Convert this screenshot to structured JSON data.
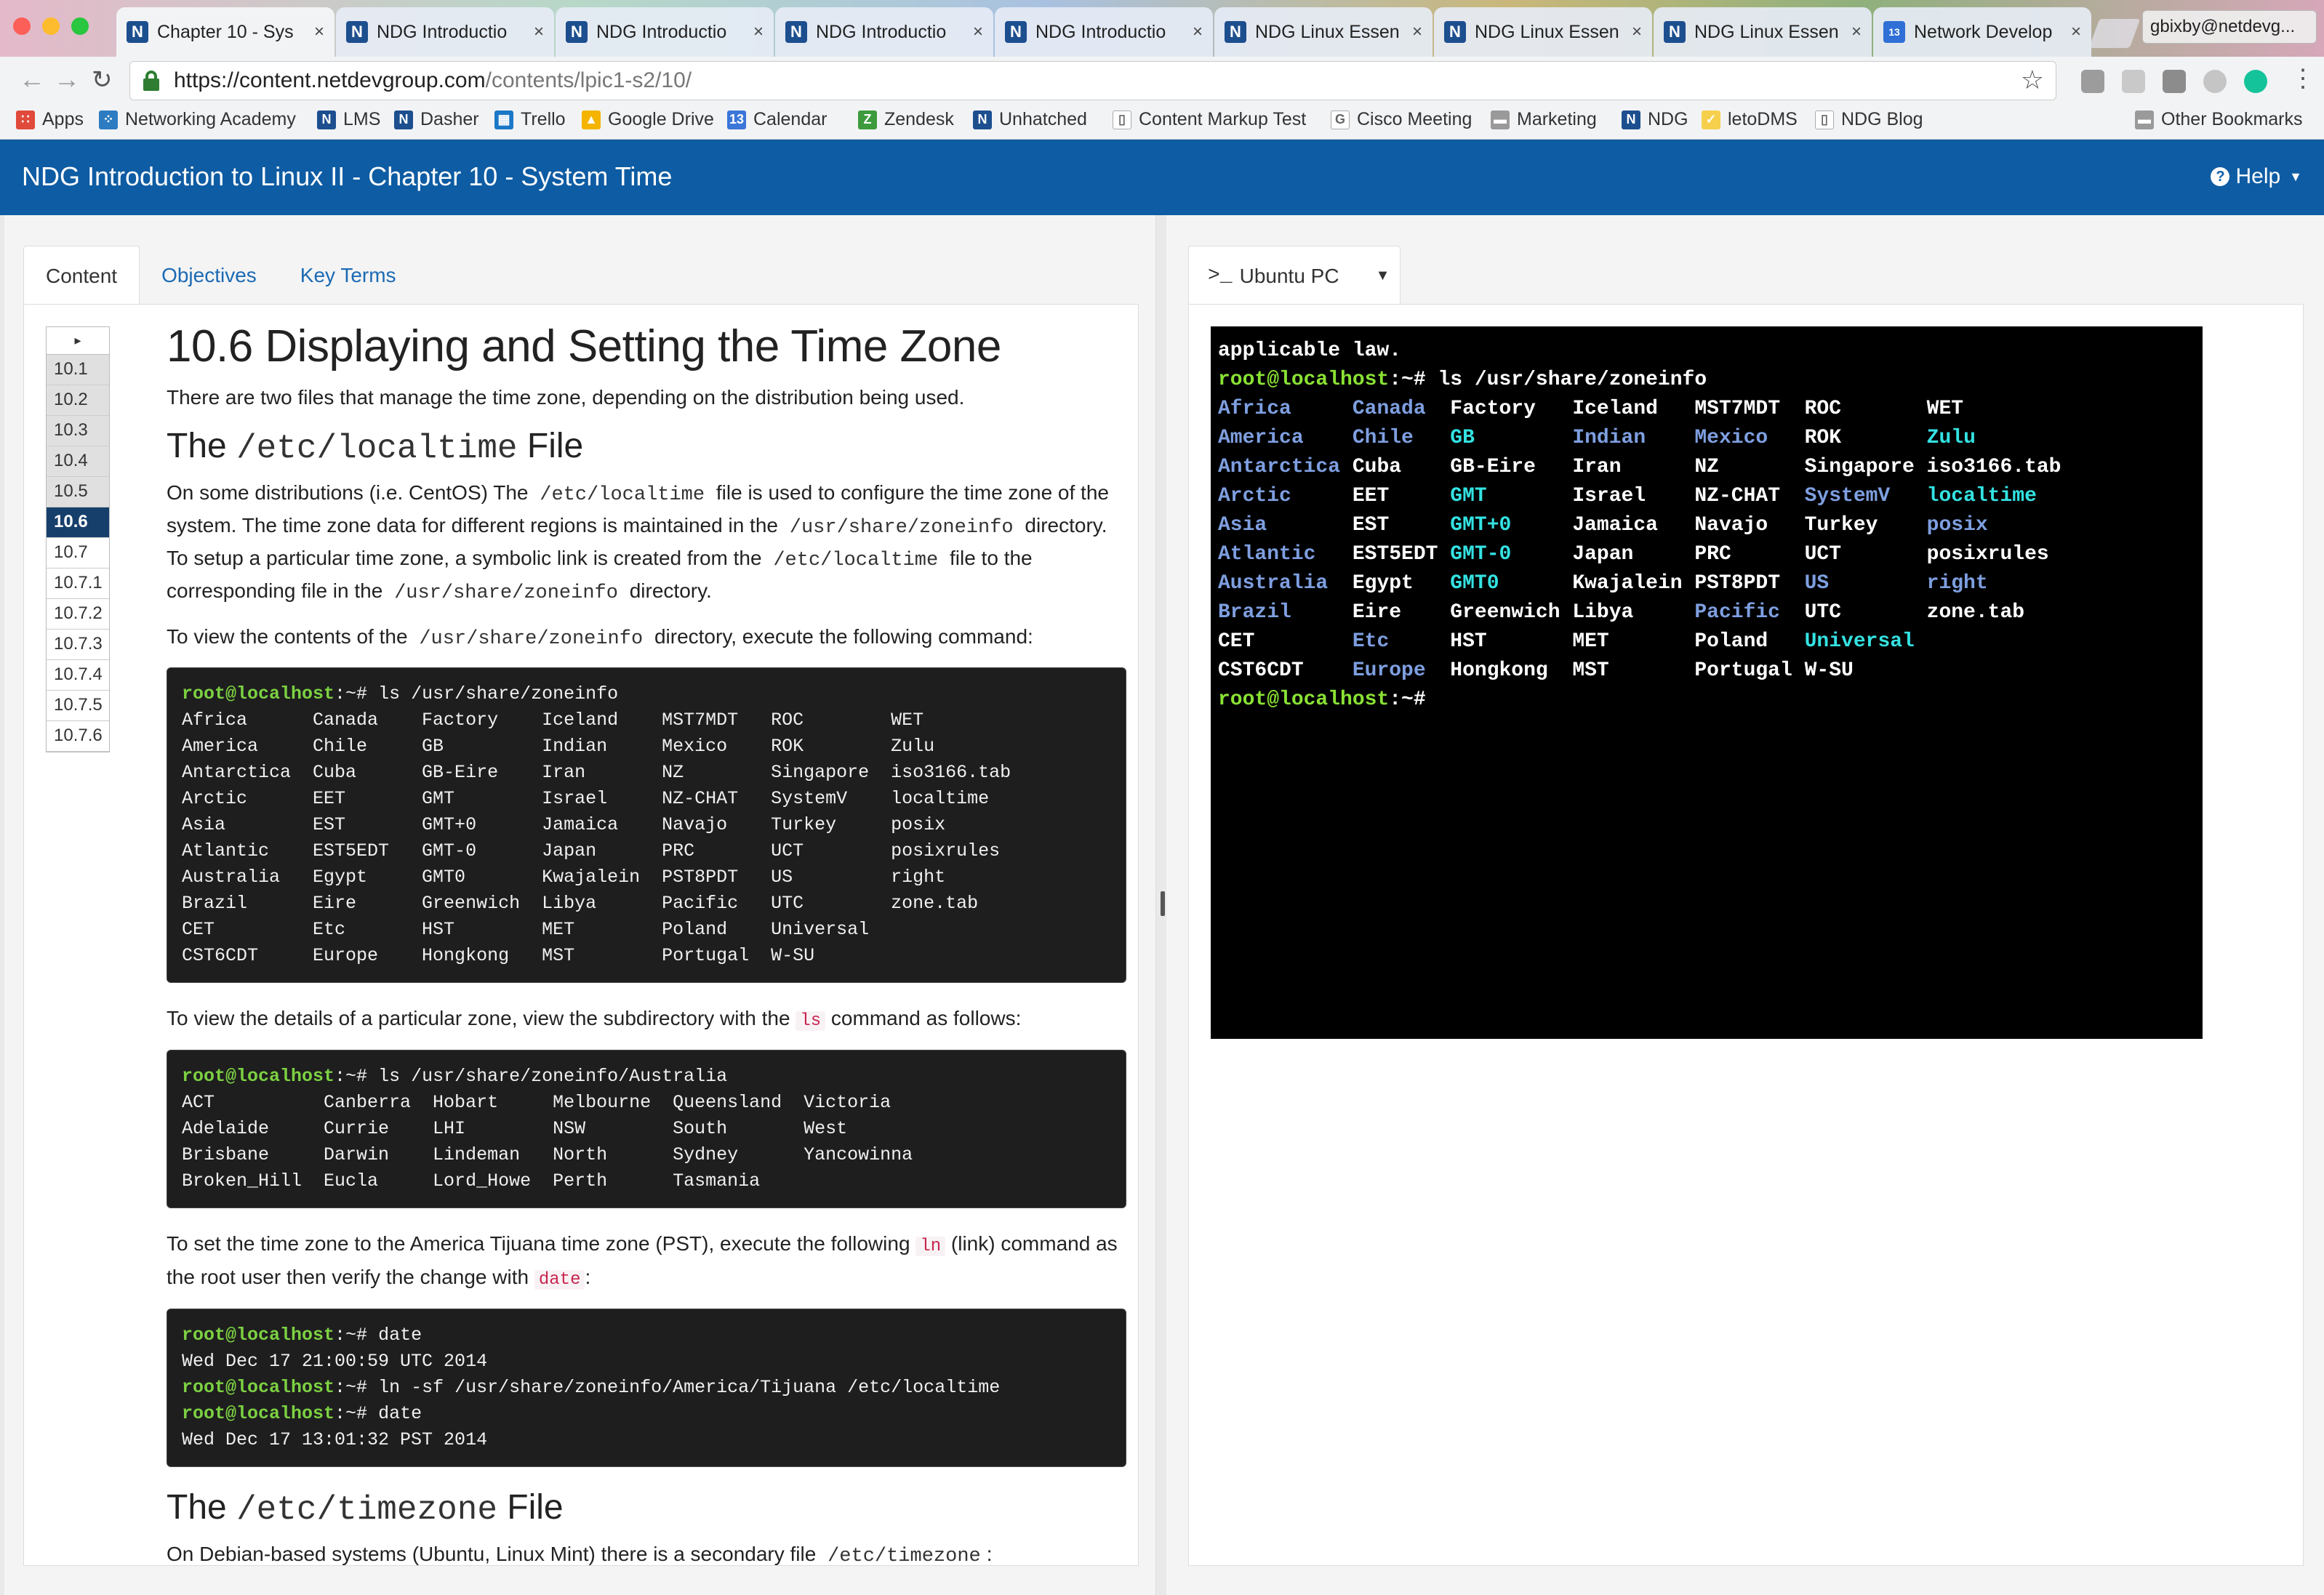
{
  "browser": {
    "tabs": [
      {
        "icon": "N",
        "title": "Chapter 10 - Sys",
        "active": true
      },
      {
        "icon": "N",
        "title": "NDG Introductio"
      },
      {
        "icon": "N",
        "title": "NDG Introductio"
      },
      {
        "icon": "N",
        "title": "NDG Introductio"
      },
      {
        "icon": "N",
        "title": "NDG Introductio"
      },
      {
        "icon": "N",
        "title": "NDG Linux Essen"
      },
      {
        "icon": "N",
        "title": "NDG Linux Essen"
      },
      {
        "icon": "N",
        "title": "NDG Linux Essen"
      },
      {
        "icon": "13",
        "title": "Network Develop"
      }
    ],
    "profile": "gbixby@netdevg...",
    "url_host": "https://content.netdevgroup.com",
    "url_path": "/contents/lpic1-s2/10/",
    "bookmarks": [
      {
        "label": "Apps",
        "icon": "apps-grid-icon"
      },
      {
        "label": "Networking Academy",
        "icon": "cisco-icon"
      },
      {
        "label": "LMS",
        "icon": "ndg-n-icon"
      },
      {
        "label": "Dasher",
        "icon": "ndg-n-icon"
      },
      {
        "label": "Trello",
        "icon": "trello-icon"
      },
      {
        "label": "Google Drive",
        "icon": "drive-icon"
      },
      {
        "label": "Calendar",
        "icon": "calendar-icon"
      },
      {
        "label": "Zendesk",
        "icon": "zendesk-icon"
      },
      {
        "label": "Unhatched",
        "icon": "ndg-n-icon"
      },
      {
        "label": "Content Markup Test",
        "icon": "page-icon"
      },
      {
        "label": "Cisco Meeting",
        "icon": "google-icon"
      },
      {
        "label": "Marketing",
        "icon": "folder-icon"
      },
      {
        "label": "NDG",
        "icon": "ndg-n-icon"
      },
      {
        "label": "letoDMS",
        "icon": "leto-icon"
      },
      {
        "label": "NDG Blog",
        "icon": "page-icon"
      },
      {
        "label": "Other Bookmarks",
        "icon": "folder-icon"
      }
    ]
  },
  "header": {
    "title": "NDG Introduction to Linux II - Chapter 10 - System Time",
    "help": "Help"
  },
  "content_tabs": [
    "Content",
    "Objectives",
    "Key Terms"
  ],
  "section_nav": [
    "10.1",
    "10.2",
    "10.3",
    "10.4",
    "10.5",
    "10.6",
    "10.7",
    "10.7.1",
    "10.7.2",
    "10.7.3",
    "10.7.4",
    "10.7.5",
    "10.7.6"
  ],
  "section_nav_active": "10.6",
  "article": {
    "title": "10.6 Displaying and Setting the Time Zone",
    "intro": "There are two files that manage the time zone, depending on the distribution being used.",
    "h2_localtime": {
      "pre": "The",
      "code": "/etc/localtime",
      "post": "File"
    },
    "p1": {
      "a": "On some distributions (i.e. CentOS) The",
      "c1": "/etc/localtime",
      "b": "file is used to configure the time zone of the system. The time zone data for different regions is maintained in the",
      "c2": "/usr/share/zoneinfo",
      "c": "directory. To setup a particular time zone, a symbolic link is created from the",
      "c3": "/etc/localtime",
      "d": "file to the corresponding file in the",
      "c4": "/usr/share/zoneinfo",
      "e": "directory."
    },
    "p2": {
      "a": "To view the contents of the",
      "c1": "/usr/share/zoneinfo",
      "b": "directory, execute the following command:"
    },
    "code1": {
      "prompt": "root@localhost",
      "suffix": ":~#",
      "command": " ls /usr/share/zoneinfo",
      "output": "Africa      Canada    Factory    Iceland    MST7MDT   ROC        WET\nAmerica     Chile     GB         Indian     Mexico    ROK        Zulu\nAntarctica  Cuba      GB-Eire    Iran       NZ        Singapore  iso3166.tab\nArctic      EET       GMT        Israel     NZ-CHAT   SystemV    localtime\nAsia        EST       GMT+0      Jamaica    Navajo    Turkey     posix\nAtlantic    EST5EDT   GMT-0      Japan      PRC       UCT        posixrules\nAustralia   Egypt     GMT0       Kwajalein  PST8PDT   US         right\nBrazil      Eire      Greenwich  Libya      Pacific   UTC        zone.tab\nCET         Etc       HST        MET        Poland    Universal\nCST6CDT     Europe    Hongkong   MST        Portugal  W-SU"
    },
    "p3": {
      "a": "To view the details of a particular zone, view the subdirectory with the",
      "c1": "ls",
      "b": "command as follows:"
    },
    "code2": {
      "prompt": "root@localhost",
      "suffix": ":~#",
      "command": " ls /usr/share/zoneinfo/Australia",
      "output": "ACT          Canberra  Hobart     Melbourne  Queensland  Victoria\nAdelaide     Currie    LHI        NSW        South       West\nBrisbane     Darwin    Lindeman   North      Sydney      Yancowinna\nBroken_Hill  Eucla     Lord_Howe  Perth      Tasmania"
    },
    "p4": {
      "a": "To set the time zone to the America Tijuana time zone (PST), execute the following",
      "c1": "ln",
      "b": "(link) command as the root user then verify the change with",
      "c2": "date",
      "c": ":"
    },
    "code3": {
      "prompt": "root@localhost",
      "suffix": ":~#",
      "cmd1": " date",
      "out1": "Wed Dec 17 21:00:59 UTC 2014",
      "cmd2": " ln -sf /usr/share/zoneinfo/America/Tijuana /etc/localtime",
      "cmd3": " date",
      "out3": "Wed Dec 17 13:01:32 PST 2014"
    },
    "h2_timezone": {
      "pre": "The",
      "code": "/etc/timezone",
      "post": "File"
    },
    "p5": {
      "a": "On Debian-based systems (Ubuntu, Linux Mint) there is a secondary file",
      "c1": "/etc/timezone",
      "b": ":"
    }
  },
  "terminal_tab": {
    "label": "Ubuntu PC"
  },
  "terminal": {
    "line0": "applicable law.",
    "prompt": "root@localhost",
    "suffix": ":~#",
    "command": " ls /usr/share/zoneinfo",
    "rows": [
      [
        [
          "Africa",
          "b"
        ],
        [
          "Canada",
          "b"
        ],
        [
          "Factory",
          "w"
        ],
        [
          "Iceland",
          "w"
        ],
        [
          "MST7MDT",
          "w"
        ],
        [
          "ROC",
          "w"
        ],
        [
          "WET",
          "w"
        ]
      ],
      [
        [
          "America",
          "b"
        ],
        [
          "Chile",
          "b"
        ],
        [
          "GB",
          "c"
        ],
        [
          "Indian",
          "b"
        ],
        [
          "Mexico",
          "b"
        ],
        [
          "ROK",
          "w"
        ],
        [
          "Zulu",
          "c"
        ]
      ],
      [
        [
          "Antarctica",
          "b"
        ],
        [
          "Cuba",
          "w"
        ],
        [
          "GB-Eire",
          "w"
        ],
        [
          "Iran",
          "w"
        ],
        [
          "NZ",
          "w"
        ],
        [
          "Singapore",
          "w"
        ],
        [
          "iso3166.tab",
          "w"
        ]
      ],
      [
        [
          "Arctic",
          "b"
        ],
        [
          "EET",
          "w"
        ],
        [
          "GMT",
          "c"
        ],
        [
          "Israel",
          "w"
        ],
        [
          "NZ-CHAT",
          "w"
        ],
        [
          "SystemV",
          "b"
        ],
        [
          "localtime",
          "c"
        ]
      ],
      [
        [
          "Asia",
          "b"
        ],
        [
          "EST",
          "w"
        ],
        [
          "GMT+0",
          "c"
        ],
        [
          "Jamaica",
          "w"
        ],
        [
          "Navajo",
          "w"
        ],
        [
          "Turkey",
          "w"
        ],
        [
          "posix",
          "b"
        ]
      ],
      [
        [
          "Atlantic",
          "b"
        ],
        [
          "EST5EDT",
          "w"
        ],
        [
          "GMT-0",
          "c"
        ],
        [
          "Japan",
          "w"
        ],
        [
          "PRC",
          "w"
        ],
        [
          "UCT",
          "w"
        ],
        [
          "posixrules",
          "w"
        ]
      ],
      [
        [
          "Australia",
          "b"
        ],
        [
          "Egypt",
          "w"
        ],
        [
          "GMT0",
          "c"
        ],
        [
          "Kwajalein",
          "w"
        ],
        [
          "PST8PDT",
          "w"
        ],
        [
          "US",
          "b"
        ],
        [
          "right",
          "b"
        ]
      ],
      [
        [
          "Brazil",
          "b"
        ],
        [
          "Eire",
          "w"
        ],
        [
          "Greenwich",
          "w"
        ],
        [
          "Libya",
          "w"
        ],
        [
          "Pacific",
          "b"
        ],
        [
          "UTC",
          "w"
        ],
        [
          "zone.tab",
          "w"
        ]
      ],
      [
        [
          "CET",
          "w"
        ],
        [
          "Etc",
          "b"
        ],
        [
          "HST",
          "w"
        ],
        [
          "MET",
          "w"
        ],
        [
          "Poland",
          "w"
        ],
        [
          "Universal",
          "c"
        ]
      ],
      [
        [
          "CST6CDT",
          "w"
        ],
        [
          "Europe",
          "b"
        ],
        [
          "Hongkong",
          "w"
        ],
        [
          "MST",
          "w"
        ],
        [
          "Portugal",
          "w"
        ],
        [
          "W-SU",
          "w"
        ]
      ]
    ],
    "colors": {
      "b": "#7e9fe0",
      "c": "#34e2e2",
      "w": "#ffffff",
      "prompt": "#8ae234"
    }
  }
}
